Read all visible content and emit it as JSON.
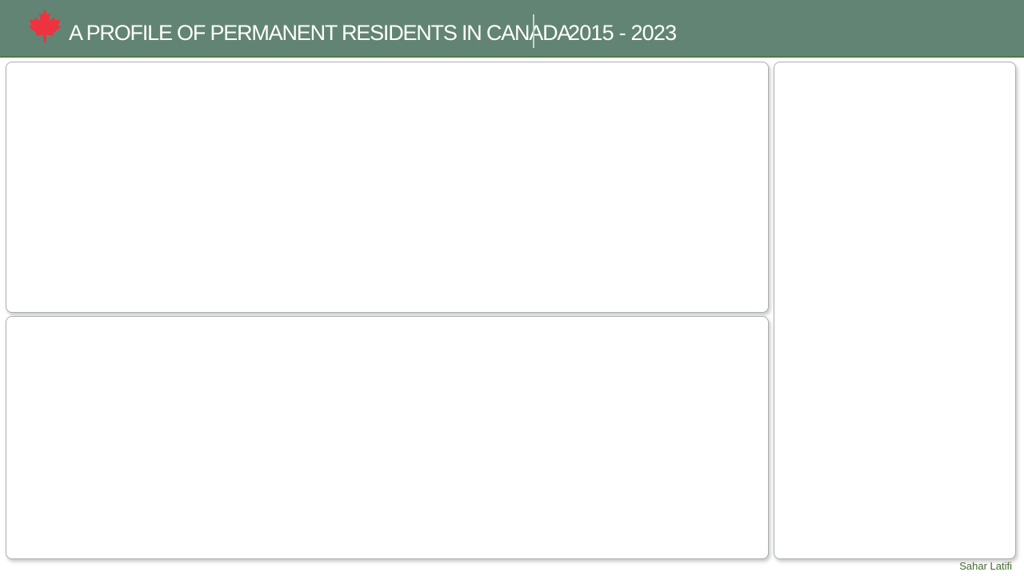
{
  "header": {
    "title": "A PROFILE OF PERMANENT RESIDENTS IN CANADA",
    "years": "2015 - 2023",
    "logo_icon": "maple-leaf-icon",
    "leaf_color": "#ee3340",
    "background_color": "#628474"
  },
  "footer": {
    "author": "Sahar Latifi"
  }
}
